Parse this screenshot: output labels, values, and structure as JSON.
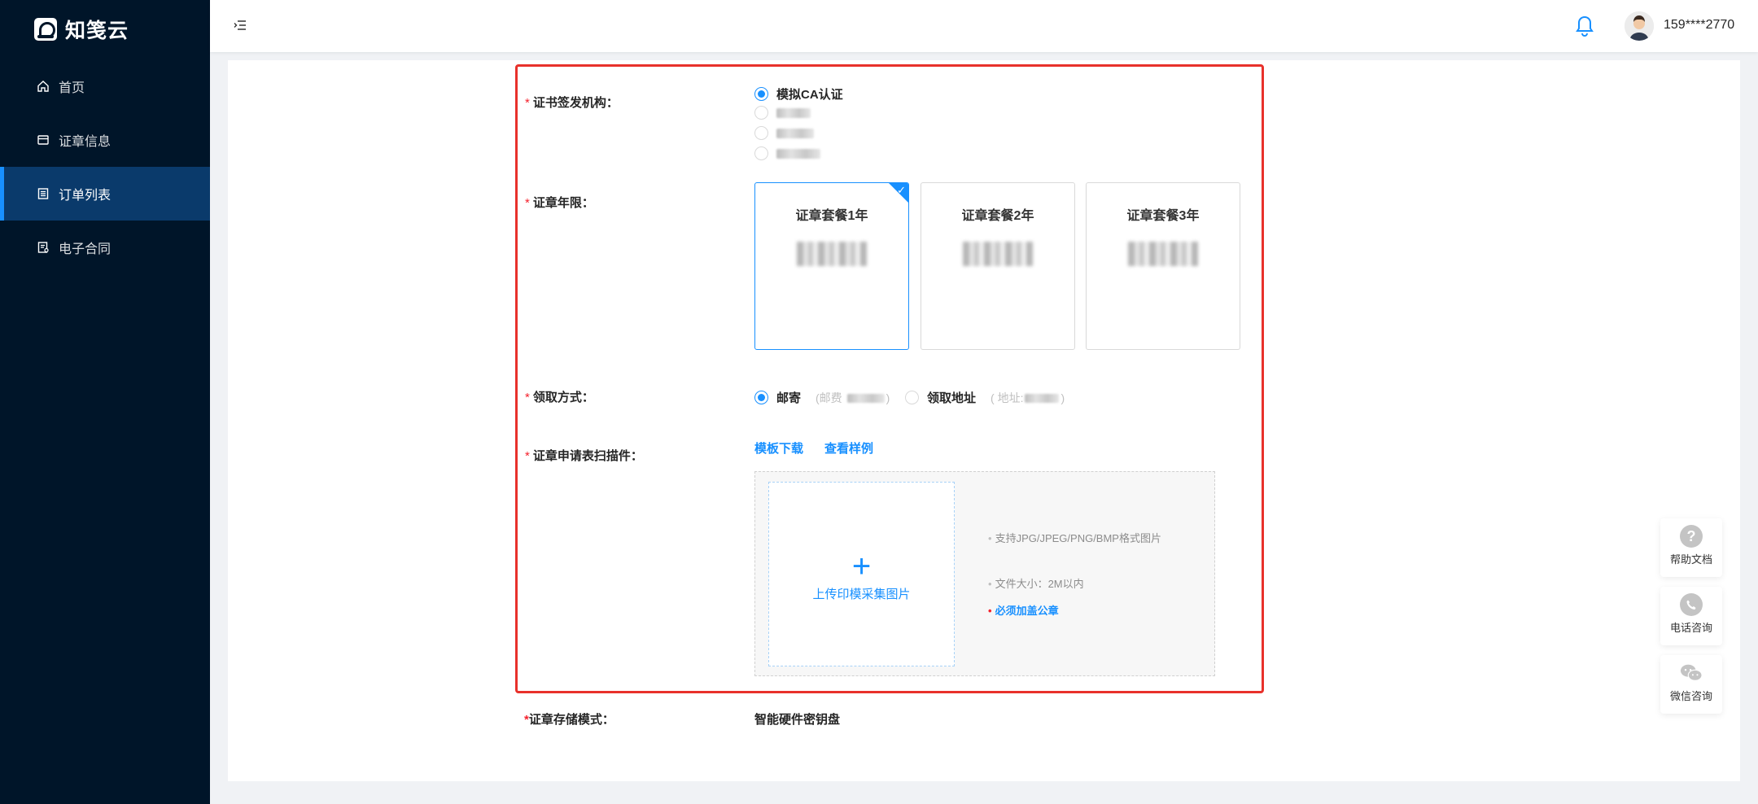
{
  "app": {
    "name": "知笺云"
  },
  "sidebar": {
    "items": [
      {
        "label": "首页",
        "icon": "home-icon"
      },
      {
        "label": "证章信息",
        "icon": "card-icon"
      },
      {
        "label": "订单列表",
        "icon": "list-icon",
        "active": true
      },
      {
        "label": "电子合同",
        "icon": "contract-icon"
      }
    ]
  },
  "header": {
    "username": "159****2770"
  },
  "form": {
    "issuer": {
      "label": "证书签发机构：",
      "options": [
        {
          "label": "模拟CA认证",
          "checked": true
        }
      ]
    },
    "term": {
      "label": "证章年限：",
      "packages": [
        {
          "title": "证章套餐1年",
          "selected": true
        },
        {
          "title": "证章套餐2年",
          "selected": false
        },
        {
          "title": "证章套餐3年",
          "selected": false
        }
      ]
    },
    "pickup": {
      "label": "领取方式：",
      "mail_label": "邮寄",
      "mail_note_prefix": "(邮费",
      "mail_note_suffix": ")",
      "self_label": "领取地址",
      "self_note_prefix": "( 地址:",
      "self_note_suffix": ")"
    },
    "scan": {
      "label": "证章申请表扫描件：",
      "template_link": "模板下载",
      "sample_link": "查看样例",
      "upload_text": "上传印模采集图片",
      "tips": [
        "支持JPG/JPEG/PNG/BMP格式图片",
        "文件大小：2M以内",
        "必须加盖公章"
      ]
    },
    "storage": {
      "label": "证章存储模式：",
      "value": "智能硬件密钥盘"
    }
  },
  "float_widgets": [
    {
      "label": "帮助文档",
      "icon": "question-icon"
    },
    {
      "label": "电话咨询",
      "icon": "phone-icon"
    },
    {
      "label": "微信咨询",
      "icon": "wechat-icon"
    }
  ],
  "colors": {
    "primary": "#1890ff",
    "sidebar": "#001529",
    "highlight": "#e8312b",
    "required": "#f5222d"
  }
}
